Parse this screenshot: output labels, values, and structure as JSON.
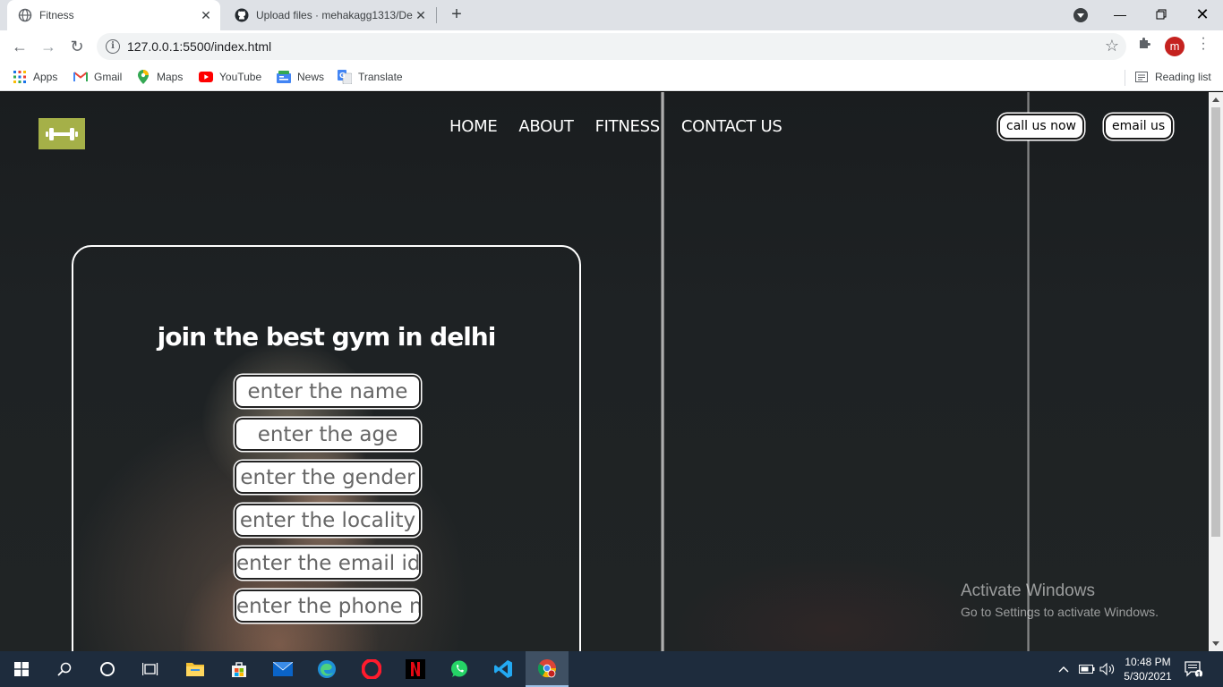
{
  "browser": {
    "tabs": [
      {
        "title": "Fitness",
        "active": true,
        "icon": "globe-icon"
      },
      {
        "title": "Upload files · mehakagg1313/De",
        "active": false,
        "icon": "github-icon"
      }
    ],
    "url": "127.0.0.1:5500/index.html",
    "profile_initial": "m",
    "bookmarks": [
      {
        "label": "Apps",
        "icon": "apps-grid-icon"
      },
      {
        "label": "Gmail",
        "icon": "gmail-icon"
      },
      {
        "label": "Maps",
        "icon": "maps-pin-icon"
      },
      {
        "label": "YouTube",
        "icon": "youtube-icon"
      },
      {
        "label": "News",
        "icon": "news-icon"
      },
      {
        "label": "Translate",
        "icon": "translate-icon"
      }
    ],
    "reading_list": "Reading list"
  },
  "site": {
    "nav": [
      "HOME",
      "ABOUT",
      "FITNESS",
      "CONTACT US"
    ],
    "call_button": "call us now",
    "email_button": "email us",
    "logo_color": "#a5b048",
    "form": {
      "title": "join the best gym in delhi",
      "fields": [
        {
          "placeholder": "enter the name"
        },
        {
          "placeholder": "enter the age"
        },
        {
          "placeholder": "enter the gender"
        },
        {
          "placeholder": "enter the locality"
        },
        {
          "placeholder": "enter the email id"
        },
        {
          "placeholder": "enter the phone n"
        }
      ]
    }
  },
  "watermark": {
    "line1": "Activate Windows",
    "line2": "Go to Settings to activate Windows."
  },
  "taskbar": {
    "apps": [
      "start-icon",
      "search-icon",
      "cortana-icon",
      "task-view-icon",
      "file-explorer-icon",
      "store-icon",
      "mail-icon",
      "edge-icon",
      "opera-icon",
      "netflix-icon",
      "whatsapp-icon",
      "vscode-icon",
      "chrome-icon"
    ],
    "time": "10:48 PM",
    "date": "5/30/2021",
    "notification_count": "1"
  }
}
